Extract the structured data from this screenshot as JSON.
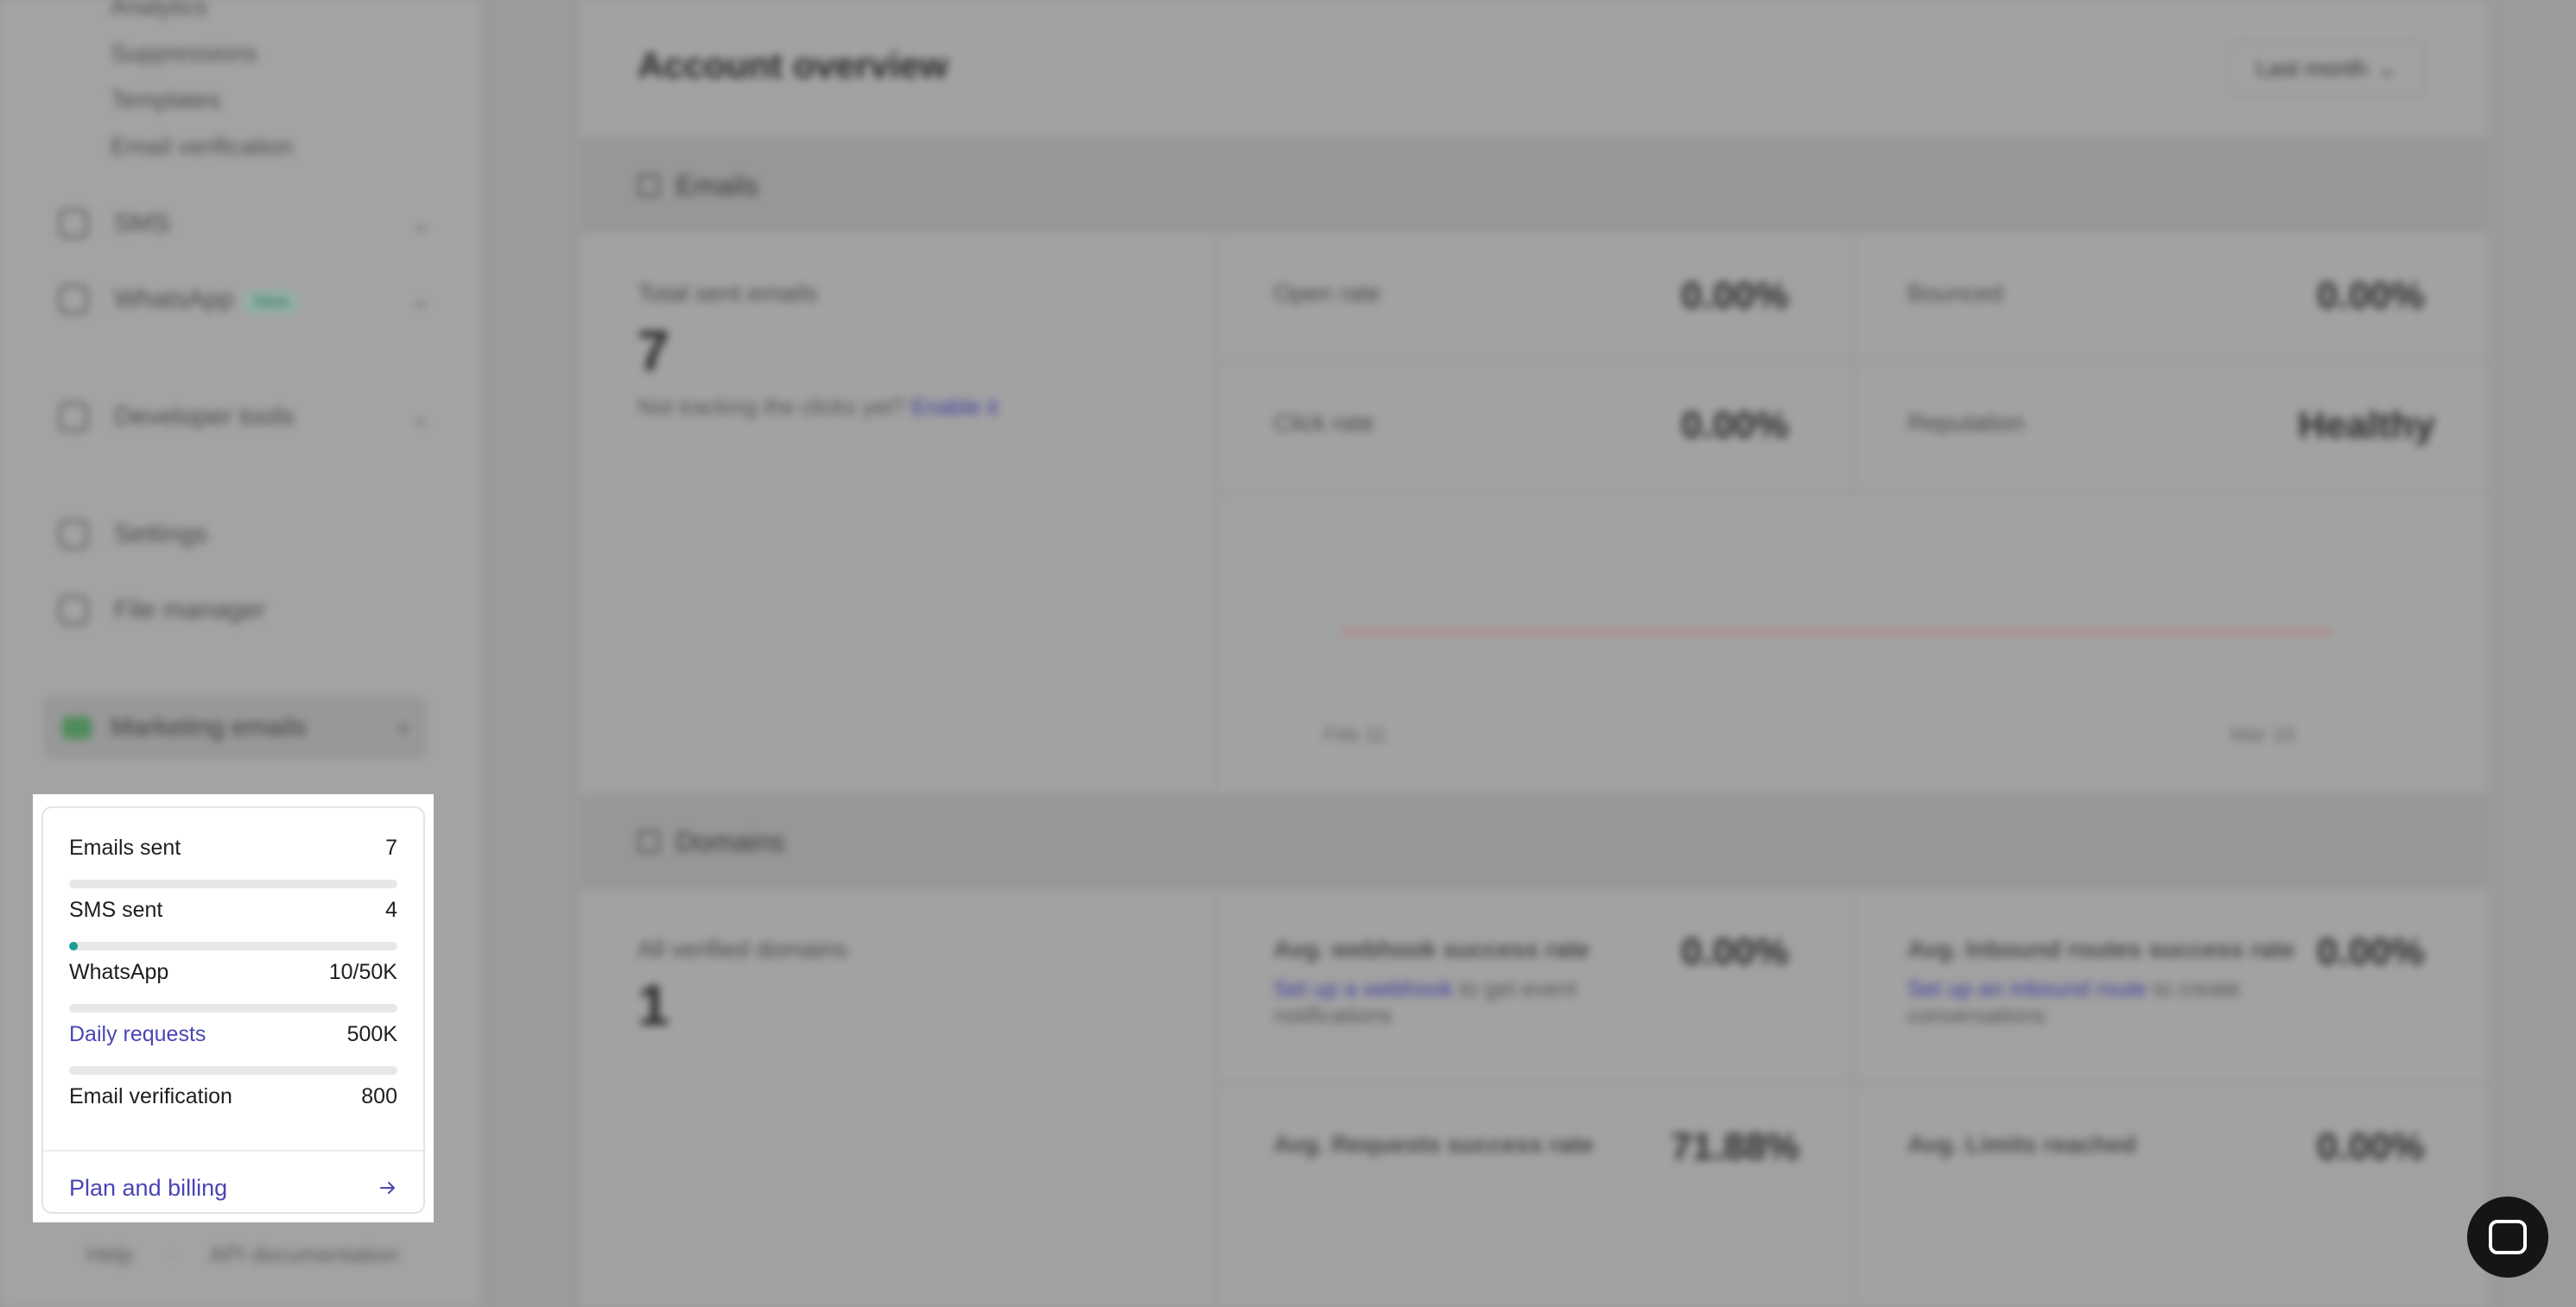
{
  "sidebar": {
    "sub_items": [
      "Analytics",
      "Suppressions",
      "Templates",
      "Email verification"
    ],
    "nav_items": [
      {
        "label": "SMS",
        "icon": "message-icon"
      },
      {
        "label": "WhatsApp",
        "icon": "whatsapp-icon",
        "badge": "New"
      },
      {
        "label": "Developer tools",
        "icon": "code-icon"
      },
      {
        "label": "Settings",
        "icon": "gear-icon"
      },
      {
        "label": "File manager",
        "icon": "folder-icon"
      }
    ],
    "marketing": {
      "label": "Marketing emails",
      "icon": "mail-icon"
    },
    "footer": {
      "help": "Help",
      "api": "API documentation"
    }
  },
  "main": {
    "title": "Account overview",
    "range_select": "Last month",
    "emails_section": {
      "title": "Emails",
      "total_label": "Total sent emails",
      "total_value": "7",
      "tracking_text": "Not tracking the clicks yet?",
      "tracking_link": "Enable it",
      "metrics": [
        {
          "label": "Open rate",
          "value": "0.00%"
        },
        {
          "label": "Bounced",
          "value": "0.00%"
        },
        {
          "label": "Click rate",
          "value": "0.00%"
        },
        {
          "label": "Reputation",
          "value": "Healthy"
        }
      ],
      "chart_ticks": [
        "Feb 11",
        "Mar 10"
      ]
    },
    "domains_section": {
      "title": "Domains",
      "verified_label": "All verified domains",
      "verified_value": "1",
      "metrics": [
        {
          "label": "Avg. webhook success rate",
          "value": "0.00%",
          "link": "Set up a webhook",
          "rest": "to get event notifications"
        },
        {
          "label": "Avg. Inbound routes success rate",
          "value": "0.00%",
          "link": "Set up an inbound route",
          "rest": "to create conversations"
        },
        {
          "label": "Avg. Requests success rate",
          "value": "71.88%"
        },
        {
          "label": "Avg. Limits reached",
          "value": "0.00%"
        }
      ]
    }
  },
  "usage": {
    "rows": [
      {
        "label": "Emails sent",
        "value": "7",
        "fill": 0.0
      },
      {
        "label": "SMS sent",
        "value": "4",
        "fill": 0.025
      },
      {
        "label": "WhatsApp",
        "value": "10/50K",
        "fill": 0.0
      },
      {
        "label": "Daily requests",
        "value": "500K",
        "fill": 0.0
      },
      {
        "label": "Email verification",
        "value": "800"
      }
    ],
    "plan_link": "Plan and billing",
    "accent_color": "#4a45b5",
    "fill_color": "#1d9c94"
  }
}
